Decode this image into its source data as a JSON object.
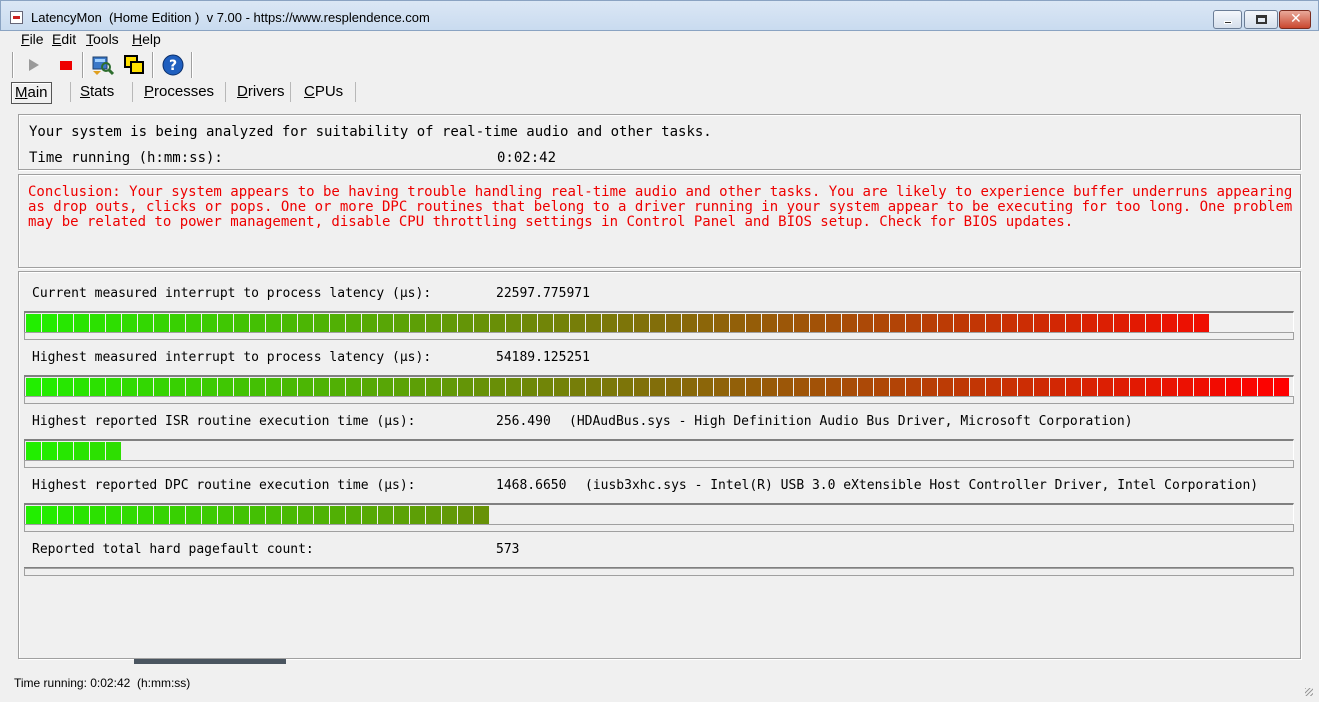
{
  "window": {
    "title": "LatencyMon  (Home Edition )  v 7.00 - https://www.resplendence.com"
  },
  "menu": [
    {
      "label": "File",
      "mnemonic": "F",
      "rest": "ile"
    },
    {
      "label": "Edit",
      "mnemonic": "E",
      "rest": "dit"
    },
    {
      "label": "Tools",
      "mnemonic": "T",
      "rest": "ools"
    },
    {
      "label": "Help",
      "mnemonic": "H",
      "rest": "elp"
    }
  ],
  "toolbar": {
    "icons": [
      "play-icon",
      "stop-icon",
      "drivers-search-icon",
      "windows-icon",
      "help-icon"
    ],
    "colors": {
      "play": "#9a9a9a",
      "stop": "#ee0000",
      "help": "#1f5fbf"
    }
  },
  "tabs": [
    {
      "label": "Main",
      "mnemonic": "M",
      "rest": "ain",
      "active": true
    },
    {
      "label": "Stats",
      "mnemonic": "S",
      "rest": "tats",
      "active": false
    },
    {
      "label": "Processes",
      "mnemonic": "P",
      "rest": "rocesses",
      "active": false
    },
    {
      "label": "Drivers",
      "mnemonic": "D",
      "rest": "rivers",
      "active": false
    },
    {
      "label": "CPUs",
      "mnemonic": "C",
      "rest": "PUs",
      "active": false
    }
  ],
  "status_panel": {
    "analyzing_text": "Your system is being analyzed for suitability of real-time audio and other tasks.",
    "time_running_label": "Time running (h:mm:ss):",
    "time_running_value": "0:02:42"
  },
  "conclusion": {
    "text": "Conclusion: Your system appears to be having trouble handling real-time audio and other tasks. You are likely to experience buffer underruns appearing as drop outs, clicks or pops. One or more DPC routines that belong to a driver running in your system appear to be executing for too long. One problem may be related to power management, disable CPU throttling settings in Control Panel and BIOS setup. Check for BIOS updates.",
    "color": "#ee0000"
  },
  "metrics": [
    {
      "label": "Current measured interrupt to process latency (µs):",
      "value": "22597.775971",
      "extra": "",
      "fill_fraction": 0.933
    },
    {
      "label": "Highest measured interrupt to process latency (µs):",
      "value": "54189.125251",
      "extra": "",
      "fill_fraction": 1.0
    },
    {
      "label": "Highest reported ISR routine execution time (µs):",
      "value": "256.490",
      "extra": "(HDAudBus.sys - High Definition Audio Bus Driver, Microsoft Corporation)",
      "fill_fraction": 0.074
    },
    {
      "label": "Highest reported DPC routine execution time (µs):",
      "value": "1468.6650",
      "extra": "(iusb3xhc.sys - Intel(R) USB 3.0 eXtensible Host Controller Driver, Intel Corporation)",
      "fill_fraction": 0.365
    },
    {
      "label": "Reported total hard pagefault count:",
      "value": "573",
      "extra": "",
      "fill_fraction": 0
    }
  ],
  "bar_colors": {
    "start": "#22ee00",
    "end": "#ff0000"
  },
  "statusbar": {
    "text": "Time running: 0:02:42  (h:mm:ss)"
  }
}
